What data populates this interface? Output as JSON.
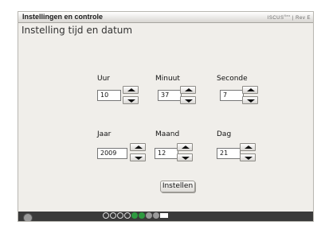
{
  "window": {
    "title": "Instellingen en controle",
    "brand": "ISCUS",
    "brand_suffix": "flex",
    "brand_rev": "Rev E"
  },
  "page": {
    "title": "Instelling tijd en datum"
  },
  "fields": {
    "uur": {
      "label": "Uur",
      "value": "10"
    },
    "minuut": {
      "label": "Minuut",
      "value": "37"
    },
    "seconde": {
      "label": "Seconde",
      "value": "7"
    },
    "jaar": {
      "label": "Jaar",
      "value": "2009"
    },
    "maand": {
      "label": "Maand",
      "value": "12"
    },
    "dag": {
      "label": "Dag",
      "value": "21"
    }
  },
  "actions": {
    "set_label": "Instellen"
  },
  "icons": {
    "up": "arrow-up-icon",
    "down": "arrow-down-icon"
  },
  "colors": {
    "panel_bg": "#f0eeea",
    "status_green": "#2e9a40"
  }
}
